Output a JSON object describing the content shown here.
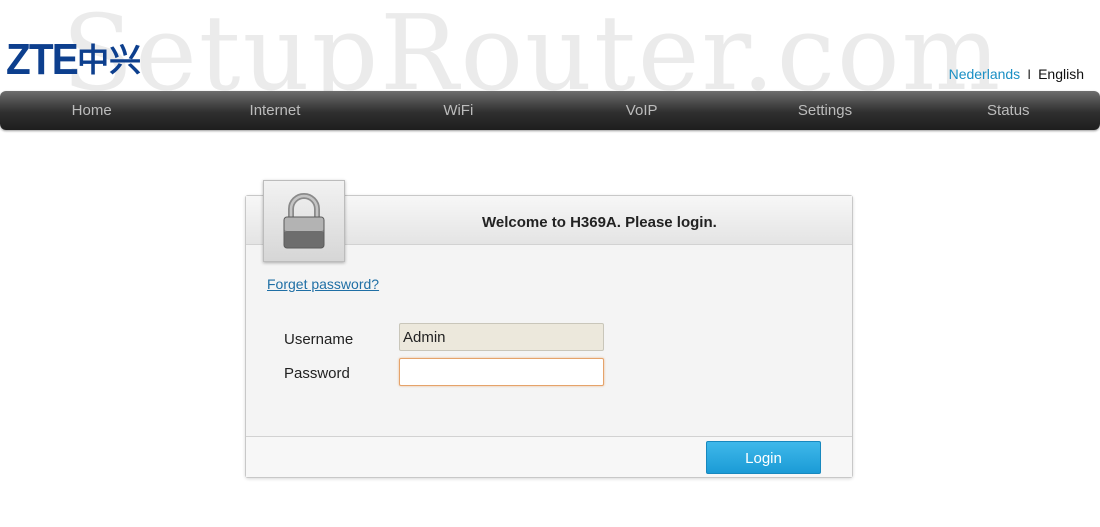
{
  "watermark": "SetupRouter.com",
  "brand": {
    "logo_text": "ZTE",
    "logo_chinese": "中兴",
    "color": "#0d3f8e"
  },
  "language": {
    "option_1": "Nederlands",
    "separator": "I",
    "option_2": "English"
  },
  "nav": {
    "items": [
      {
        "label": "Home"
      },
      {
        "label": "Internet"
      },
      {
        "label": "WiFi"
      },
      {
        "label": "VoIP"
      },
      {
        "label": "Settings"
      },
      {
        "label": "Status"
      }
    ]
  },
  "login": {
    "title": "Welcome to H369A. Please login.",
    "forgot_label": "Forget password?",
    "username_label": "Username",
    "username_value": "Admin",
    "password_label": "Password",
    "password_value": "",
    "button_label": "Login",
    "lock_icon": "padlock-icon",
    "accent_color": "#1b9bd6"
  }
}
